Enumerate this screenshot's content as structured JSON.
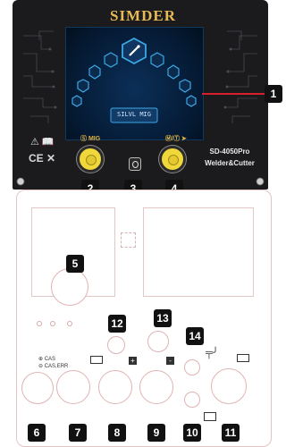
{
  "brand": "SIMDER",
  "front_panel": {
    "knob_left_label": "Ⓢ MIG",
    "knob_right_label": "Ⓜ/Ⓣ ➤",
    "model_line1": "SD-4050Pro",
    "model_line2": "Welder&Cutter",
    "screen_text": "SILVL MIG",
    "warning_icons": "⚠ 📖"
  },
  "callouts": [
    "1",
    "2",
    "3",
    "4",
    "5",
    "6",
    "7",
    "8",
    "9",
    "10",
    "11",
    "12",
    "13",
    "14"
  ],
  "port_labels": {
    "port6_line1": "⊕ CAS",
    "port6_line2": "⊖ CAS,ERR",
    "plus": "+",
    "minus": "-"
  },
  "colors": {
    "panel_dark": "#1b1b1d",
    "accent_gold": "#e7ba56",
    "knob_yellow": "#f1d83a",
    "screen_blue": "#0b2f58",
    "callout_red": "#d6202b",
    "outline_pink": "#e4c3c3"
  }
}
